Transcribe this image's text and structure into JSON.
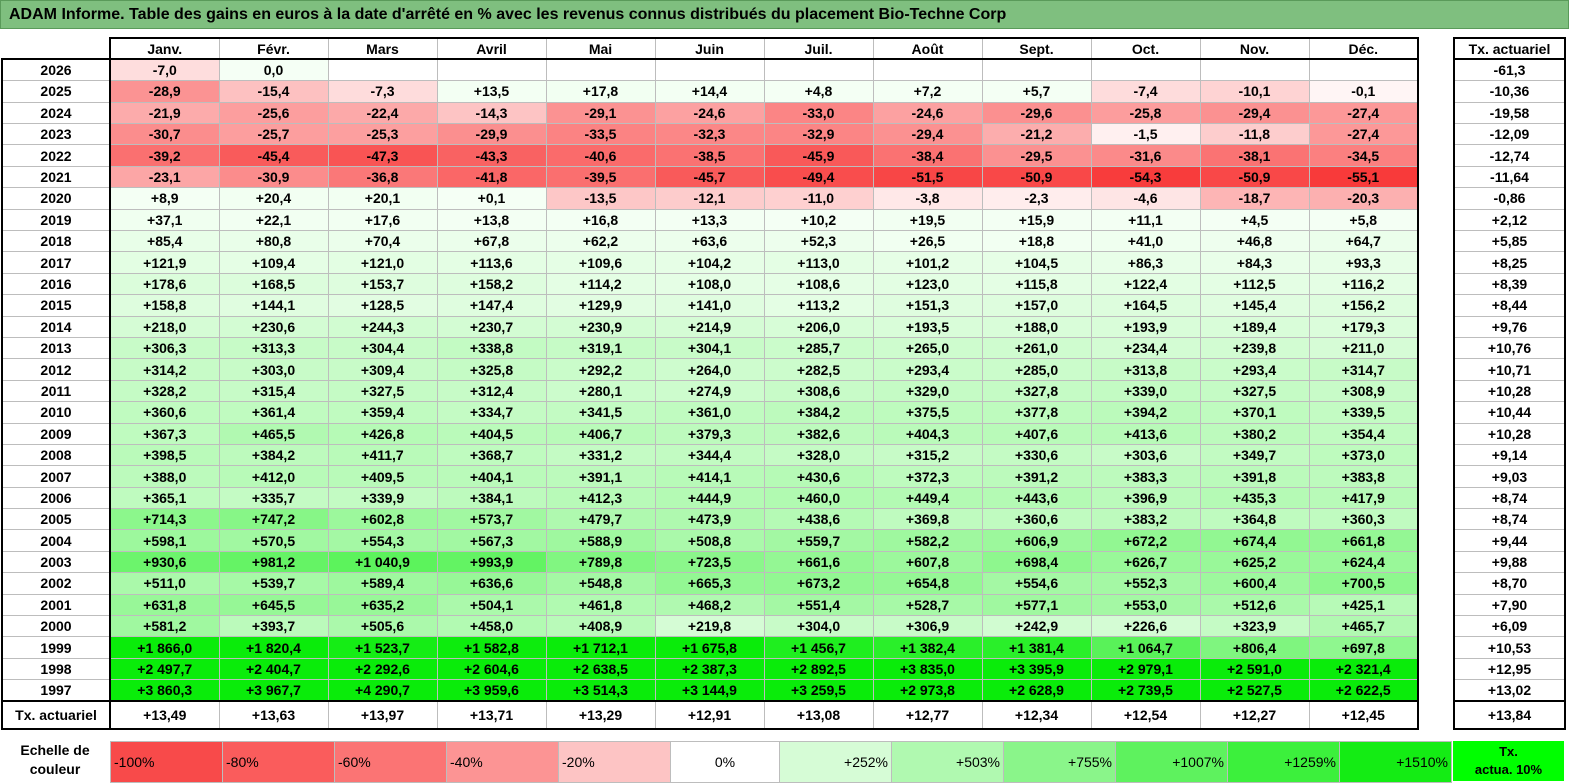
{
  "title": "ADAM Informe. Table des gains en euros à la date d'arrêté en % avec les revenus connus distribués du placement Bio-Techne Corp",
  "months": [
    "Janv.",
    "Févr.",
    "Mars",
    "Avril",
    "Mai",
    "Juin",
    "Juil.",
    "Août",
    "Sept.",
    "Oct.",
    "Nov.",
    "Déc."
  ],
  "rate_header": "Tx. actuariel",
  "rows": [
    {
      "year": "2026",
      "values": [
        "-7,0",
        "0,0",
        "",
        "",
        "",
        "",
        "",
        "",
        "",
        "",
        "",
        ""
      ],
      "rate": "-61,3"
    },
    {
      "year": "2025",
      "values": [
        "-28,9",
        "-15,4",
        "-7,3",
        "+13,5",
        "+17,8",
        "+14,4",
        "+4,8",
        "+7,2",
        "+5,7",
        "-7,4",
        "-10,1",
        "-0,1"
      ],
      "rate": "-10,36"
    },
    {
      "year": "2024",
      "values": [
        "-21,9",
        "-25,6",
        "-22,4",
        "-14,3",
        "-29,1",
        "-24,6",
        "-33,0",
        "-24,6",
        "-29,6",
        "-25,8",
        "-29,4",
        "-27,4"
      ],
      "rate": "-19,58"
    },
    {
      "year": "2023",
      "values": [
        "-30,7",
        "-25,7",
        "-25,3",
        "-29,9",
        "-33,5",
        "-32,3",
        "-32,9",
        "-29,4",
        "-21,2",
        "-1,5",
        "-11,8",
        "-27,4"
      ],
      "rate": "-12,09"
    },
    {
      "year": "2022",
      "values": [
        "-39,2",
        "-45,4",
        "-47,3",
        "-43,3",
        "-40,6",
        "-38,5",
        "-45,9",
        "-38,4",
        "-29,5",
        "-31,6",
        "-38,1",
        "-34,5"
      ],
      "rate": "-12,74"
    },
    {
      "year": "2021",
      "values": [
        "-23,1",
        "-30,9",
        "-36,8",
        "-41,8",
        "-39,5",
        "-45,7",
        "-49,4",
        "-51,5",
        "-50,9",
        "-54,3",
        "-50,9",
        "-55,1"
      ],
      "rate": "-11,64"
    },
    {
      "year": "2020",
      "values": [
        "+8,9",
        "+20,4",
        "+20,1",
        "+0,1",
        "-13,5",
        "-12,1",
        "-11,0",
        "-3,8",
        "-2,3",
        "-4,6",
        "-18,7",
        "-20,3"
      ],
      "rate": "-0,86"
    },
    {
      "year": "2019",
      "values": [
        "+37,1",
        "+22,1",
        "+17,6",
        "+13,8",
        "+16,8",
        "+13,3",
        "+10,2",
        "+19,5",
        "+15,9",
        "+11,1",
        "+4,5",
        "+5,8"
      ],
      "rate": "+2,12"
    },
    {
      "year": "2018",
      "values": [
        "+85,4",
        "+80,8",
        "+70,4",
        "+67,8",
        "+62,2",
        "+63,6",
        "+52,3",
        "+26,5",
        "+18,8",
        "+41,0",
        "+46,8",
        "+64,7"
      ],
      "rate": "+5,85"
    },
    {
      "year": "2017",
      "values": [
        "+121,9",
        "+109,4",
        "+121,0",
        "+113,6",
        "+109,6",
        "+104,2",
        "+113,0",
        "+101,2",
        "+104,5",
        "+86,3",
        "+84,3",
        "+93,3"
      ],
      "rate": "+8,25"
    },
    {
      "year": "2016",
      "values": [
        "+178,6",
        "+168,5",
        "+153,7",
        "+158,2",
        "+114,2",
        "+108,0",
        "+108,6",
        "+123,0",
        "+115,8",
        "+122,4",
        "+112,5",
        "+116,2"
      ],
      "rate": "+8,39"
    },
    {
      "year": "2015",
      "values": [
        "+158,8",
        "+144,1",
        "+128,5",
        "+147,4",
        "+129,9",
        "+141,0",
        "+113,2",
        "+151,3",
        "+157,0",
        "+164,5",
        "+145,4",
        "+156,2"
      ],
      "rate": "+8,44"
    },
    {
      "year": "2014",
      "values": [
        "+218,0",
        "+230,6",
        "+244,3",
        "+230,7",
        "+230,9",
        "+214,9",
        "+206,0",
        "+193,5",
        "+188,0",
        "+193,9",
        "+189,4",
        "+179,3"
      ],
      "rate": "+9,76"
    },
    {
      "year": "2013",
      "values": [
        "+306,3",
        "+313,3",
        "+304,4",
        "+338,8",
        "+319,1",
        "+304,1",
        "+285,7",
        "+265,0",
        "+261,0",
        "+234,4",
        "+239,8",
        "+211,0"
      ],
      "rate": "+10,76"
    },
    {
      "year": "2012",
      "values": [
        "+314,2",
        "+303,0",
        "+309,4",
        "+325,8",
        "+292,2",
        "+264,0",
        "+282,5",
        "+293,4",
        "+285,0",
        "+313,8",
        "+293,4",
        "+314,7"
      ],
      "rate": "+10,71"
    },
    {
      "year": "2011",
      "values": [
        "+328,2",
        "+315,4",
        "+327,5",
        "+312,4",
        "+280,1",
        "+274,9",
        "+308,6",
        "+329,0",
        "+327,8",
        "+339,0",
        "+327,5",
        "+308,9"
      ],
      "rate": "+10,28"
    },
    {
      "year": "2010",
      "values": [
        "+360,6",
        "+361,4",
        "+359,4",
        "+334,7",
        "+341,5",
        "+361,0",
        "+384,2",
        "+375,5",
        "+377,8",
        "+394,2",
        "+370,1",
        "+339,5"
      ],
      "rate": "+10,44"
    },
    {
      "year": "2009",
      "values": [
        "+367,3",
        "+465,5",
        "+426,8",
        "+404,5",
        "+406,7",
        "+379,3",
        "+382,6",
        "+404,3",
        "+407,6",
        "+413,6",
        "+380,2",
        "+354,4"
      ],
      "rate": "+10,28"
    },
    {
      "year": "2008",
      "values": [
        "+398,5",
        "+384,2",
        "+411,7",
        "+368,7",
        "+331,2",
        "+344,4",
        "+328,0",
        "+315,2",
        "+330,6",
        "+303,6",
        "+349,7",
        "+373,0"
      ],
      "rate": "+9,14"
    },
    {
      "year": "2007",
      "values": [
        "+388,0",
        "+412,0",
        "+409,5",
        "+404,1",
        "+391,1",
        "+414,1",
        "+430,6",
        "+372,3",
        "+391,2",
        "+383,3",
        "+391,8",
        "+383,8"
      ],
      "rate": "+9,03"
    },
    {
      "year": "2006",
      "values": [
        "+365,1",
        "+335,7",
        "+339,9",
        "+384,1",
        "+412,3",
        "+444,9",
        "+460,0",
        "+449,4",
        "+443,6",
        "+396,9",
        "+435,3",
        "+417,9"
      ],
      "rate": "+8,74"
    },
    {
      "year": "2005",
      "values": [
        "+714,3",
        "+747,2",
        "+602,8",
        "+573,7",
        "+479,7",
        "+473,9",
        "+438,6",
        "+369,8",
        "+360,6",
        "+383,2",
        "+364,8",
        "+360,3"
      ],
      "rate": "+8,74"
    },
    {
      "year": "2004",
      "values": [
        "+598,1",
        "+570,5",
        "+554,3",
        "+567,3",
        "+588,9",
        "+508,8",
        "+559,7",
        "+582,2",
        "+606,9",
        "+672,2",
        "+674,4",
        "+661,8"
      ],
      "rate": "+9,44"
    },
    {
      "year": "2003",
      "values": [
        "+930,6",
        "+981,2",
        "+1 040,9",
        "+993,9",
        "+789,8",
        "+723,5",
        "+661,6",
        "+607,8",
        "+698,4",
        "+626,7",
        "+625,2",
        "+624,4"
      ],
      "rate": "+9,88"
    },
    {
      "year": "2002",
      "values": [
        "+511,0",
        "+539,7",
        "+589,4",
        "+636,6",
        "+548,8",
        "+665,3",
        "+673,2",
        "+654,8",
        "+554,6",
        "+552,3",
        "+600,4",
        "+700,5"
      ],
      "rate": "+8,70"
    },
    {
      "year": "2001",
      "values": [
        "+631,8",
        "+645,5",
        "+635,2",
        "+504,1",
        "+461,8",
        "+468,2",
        "+551,4",
        "+528,7",
        "+577,1",
        "+553,0",
        "+512,6",
        "+425,1"
      ],
      "rate": "+7,90"
    },
    {
      "year": "2000",
      "values": [
        "+581,2",
        "+393,7",
        "+505,6",
        "+458,0",
        "+408,9",
        "+219,8",
        "+304,0",
        "+306,9",
        "+242,9",
        "+226,6",
        "+323,9",
        "+465,7"
      ],
      "rate": "+6,09"
    },
    {
      "year": "1999",
      "values": [
        "+1 866,0",
        "+1 820,4",
        "+1 523,7",
        "+1 582,8",
        "+1 712,1",
        "+1 675,8",
        "+1 456,7",
        "+1 382,4",
        "+1 381,4",
        "+1 064,7",
        "+806,4",
        "+697,8"
      ],
      "rate": "+10,53"
    },
    {
      "year": "1998",
      "values": [
        "+2 497,7",
        "+2 404,7",
        "+2 292,6",
        "+2 604,6",
        "+2 638,5",
        "+2 387,3",
        "+2 892,5",
        "+3 835,0",
        "+3 395,9",
        "+2 979,1",
        "+2 591,0",
        "+2 321,4"
      ],
      "rate": "+12,95"
    },
    {
      "year": "1997",
      "values": [
        "+3 860,3",
        "+3 967,7",
        "+4 290,7",
        "+3 959,6",
        "+3 514,3",
        "+3 144,9",
        "+3 259,5",
        "+2 973,8",
        "+2 628,9",
        "+2 739,5",
        "+2 527,5",
        "+2 622,5"
      ],
      "rate": "+13,02"
    }
  ],
  "tx_row": {
    "label": "Tx. actuariel",
    "values": [
      "+13,49",
      "+13,63",
      "+13,97",
      "+13,71",
      "+13,29",
      "+12,91",
      "+13,08",
      "+12,77",
      "+12,34",
      "+12,54",
      "+12,27",
      "+12,45"
    ],
    "rate": "+13,84"
  },
  "legend": {
    "label_line1": "Echelle de",
    "label_line2": "couleur",
    "items": [
      {
        "text": "-100%",
        "color": "#f84a4a",
        "align": "lft"
      },
      {
        "text": "-80%",
        "color": "#fa5c5c",
        "align": "lft"
      },
      {
        "text": "-60%",
        "color": "#fb7474",
        "align": "lft"
      },
      {
        "text": "-40%",
        "color": "#fc9494",
        "align": "lft"
      },
      {
        "text": "-20%",
        "color": "#fdc4c4",
        "align": "lft"
      },
      {
        "text": "0%",
        "color": "#ffffff",
        "align": "mid"
      },
      {
        "text": "+252%",
        "color": "#d6fcd6",
        "align": "rgt"
      },
      {
        "text": "+503%",
        "color": "#b0f9b0",
        "align": "rgt"
      },
      {
        "text": "+755%",
        "color": "#8af58a",
        "align": "rgt"
      },
      {
        "text": "+1007%",
        "color": "#5ef25e",
        "align": "rgt"
      },
      {
        "text": "+1259%",
        "color": "#3cf03c",
        "align": "rgt"
      },
      {
        "text": "+1510%",
        "color": "#14ec14",
        "align": "rgt"
      }
    ],
    "rate_line1": "Tx.",
    "rate_line2": "actua. 10%"
  }
}
